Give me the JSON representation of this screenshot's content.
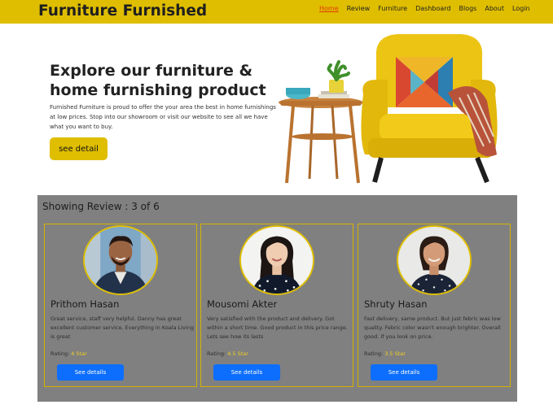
{
  "navbar": {
    "brand": "Furniture Furnished",
    "links": [
      "Home",
      "Review",
      "Furniture",
      "Dashboard",
      "Blogs",
      "About",
      "Login"
    ],
    "active_index": 0
  },
  "hero": {
    "title": "Explore our furniture & home furnishing product",
    "description": "Furnished Furniture is proud to offer the your area the best in home furnishings at low prices. Stop into our showroom or visit our website to see all we have what you want to buy.",
    "button_label": "see detail"
  },
  "reviews": {
    "heading": "Showing Review : 3 of 6",
    "rating_label": "Rating: ",
    "button_label": "See details",
    "cards": [
      {
        "name": "Prithom Hasan",
        "text": "Great service, staff very helpful. Danny has great excellent customer service. Everything in Koala Living is great",
        "rating": "4 Star"
      },
      {
        "name": "Mousomi Akter",
        "text": "Very satisfied with the product and delivery. Got within a short time. Good product in this price range. Lets see how its lasts",
        "rating": "4.5 Star"
      },
      {
        "name": "Shruty Hasan",
        "text": "Fast delivery, same product. But just febric was low quality. Febric color wasn't enough brighter. Overall good. If you look on price.",
        "rating": "3.5 Star"
      }
    ]
  },
  "colors": {
    "brand_yellow": "#dfbe00",
    "nav_active": "#e03a00",
    "section_gray": "#808080",
    "button_blue": "#0d6efd",
    "rating_yellow": "#f0cf20"
  },
  "icons": [
    "yellow-armchair-image",
    "side-table-image",
    "potted-plant-image",
    "reviewer-avatar-photo"
  ]
}
